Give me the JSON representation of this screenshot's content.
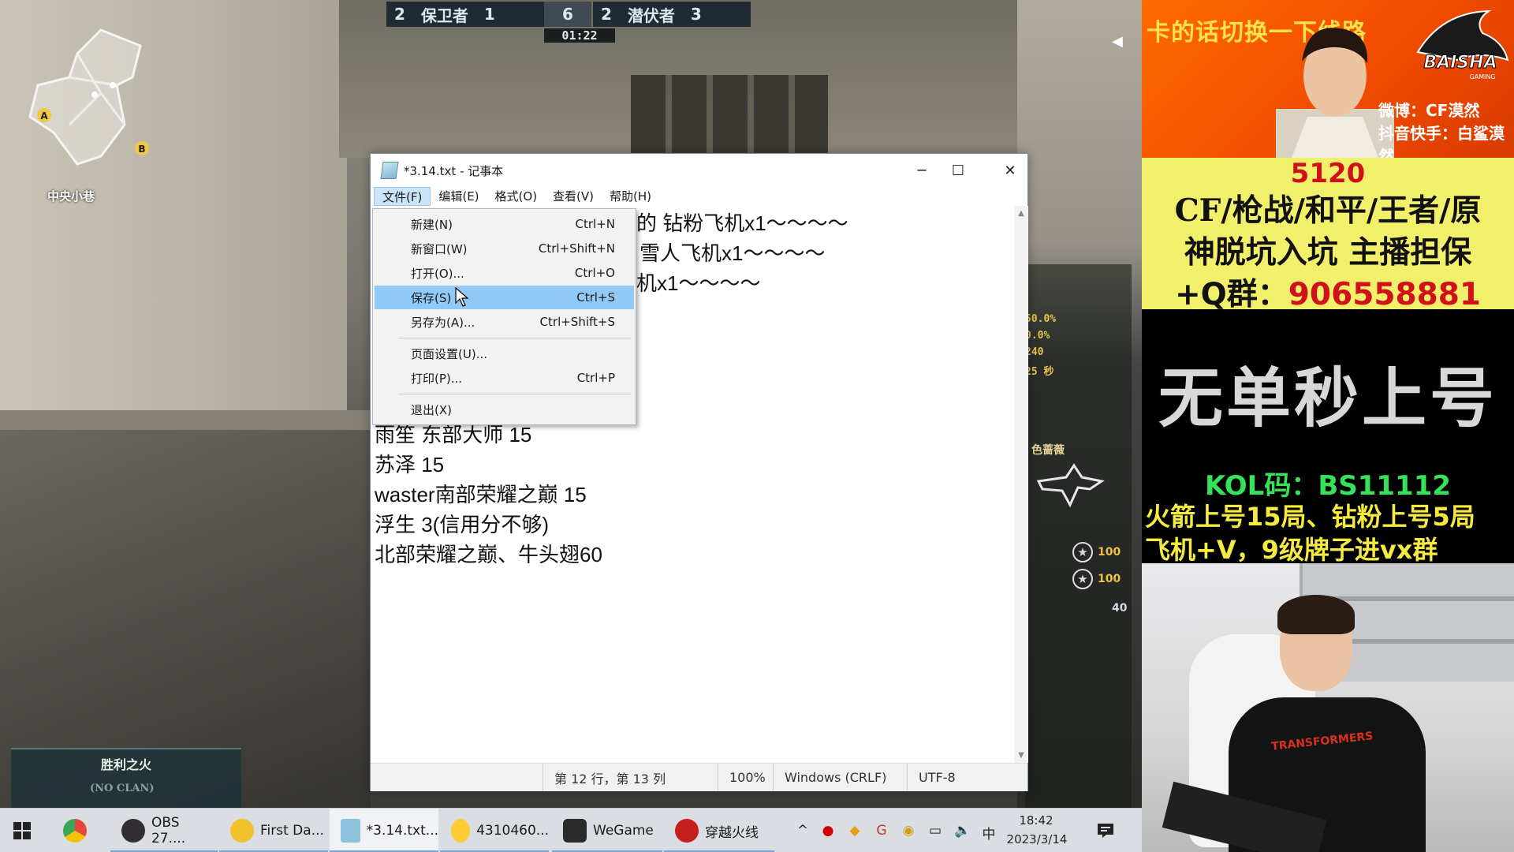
{
  "game": {
    "map_name": "中央小巷",
    "minimap_markers": [
      "A",
      "B"
    ],
    "score": {
      "left_count": "2",
      "left_team": "保卫者",
      "left_score": "1",
      "round": "6",
      "right_count": "2",
      "right_team": "潜伏者",
      "right_score": "3",
      "timer": "01:22"
    },
    "hud": {
      "pcts": [
        "50.0%",
        "0.0%",
        "240",
        "25 秒"
      ],
      "weapon_label": "色蔷薇",
      "stat_1": "100",
      "stat_2": "100",
      "ammo": "40"
    },
    "bottom_panel": {
      "title": "胜利之火",
      "subtitle": "(NO CLAN)"
    }
  },
  "notepad": {
    "title": "*3.14.txt - 记事本",
    "window_controls": [
      "─",
      "☐",
      "✕"
    ],
    "menus": [
      "文件(F)",
      "编辑(E)",
      "格式(O)",
      "查看(V)",
      "帮助(H)"
    ],
    "active_menu": "文件(F)",
    "visible_lines": [
      {
        "text": "的 钻粉飞机x1～～～～",
        "partial": true
      },
      {
        "text": "雪人飞机x1～～～～",
        "partial": true
      },
      {
        "text": "机x1～～～～",
        "partial": true
      },
      {
        "text": "雨笙 东部大师 15",
        "partial": false
      },
      {
        "text": "苏泽 15",
        "partial": false
      },
      {
        "text": "waster南部荣耀之巅 15",
        "partial": false
      },
      {
        "text": "浮生 3(信用分不够)",
        "partial": false
      },
      {
        "text": "北部荣耀之巅、牛头翅60",
        "partial": false
      }
    ],
    "status": {
      "position": "第 12 行，第 13 列",
      "zoom": "100%",
      "line_ending": "Windows (CRLF)",
      "encoding": "UTF-8"
    },
    "file_menu": [
      {
        "label": "新建(N)",
        "shortcut": "Ctrl+N"
      },
      {
        "label": "新窗口(W)",
        "shortcut": "Ctrl+Shift+N"
      },
      {
        "label": "打开(O)...",
        "shortcut": "Ctrl+O"
      },
      {
        "label": "保存(S)",
        "shortcut": "Ctrl+S",
        "highlighted": true
      },
      {
        "label": "另存为(A)...",
        "shortcut": "Ctrl+Shift+S"
      },
      {
        "label": "页面设置(U)...",
        "shortcut": ""
      },
      {
        "label": "打印(P)...",
        "shortcut": "Ctrl+P"
      },
      {
        "label": "退出(X)",
        "shortcut": ""
      }
    ]
  },
  "overlay": {
    "banner_text": "卡的话切换一下线路",
    "logo_text": "BAISHA",
    "logo_sub": "GAMING",
    "weibo": "微博：CF漠然",
    "douyin": "抖音快手：白鲨漠然",
    "promo_number": "5120",
    "promo_line1": "CF/枪战/和平/王者/原",
    "promo_line2": "神脱坑入坑 主播担保",
    "qq_label": "+Q群：",
    "qq_number": "906558881",
    "slogan": "无单秒上号",
    "kol": "KOL码：BS11112",
    "rocket": "火箭上号15局、钻粉上号5局",
    "plane": "飞机+V，9级牌子进vx群",
    "shirt_text": "TRANSFORMERS"
  },
  "taskbar": {
    "items": [
      {
        "name": "chrome",
        "label": "",
        "color": "#e8453c"
      },
      {
        "name": "obs",
        "label": "OBS 27....",
        "color": "#302e31"
      },
      {
        "name": "first-da",
        "label": "First Da...",
        "color": "#f2c12e"
      },
      {
        "name": "notepad",
        "label": "*3.14.txt...",
        "color": "#8fc3dd"
      },
      {
        "name": "qq",
        "label": "4310460...",
        "color": "#ffcc33"
      },
      {
        "name": "wegame",
        "label": "WeGame",
        "color": "#2a2a2a"
      },
      {
        "name": "cf",
        "label": "穿越火线",
        "color": "#c81e1e"
      }
    ],
    "tray": [
      "^",
      "●",
      "◆",
      "G",
      "◉",
      "▭",
      "🔈",
      "中"
    ],
    "time": "18:42",
    "date": "2023/3/14"
  },
  "colors": {
    "menu_highlight": "#91c9f7",
    "promo_bg": "#f2ef6a",
    "banner_orange": "#f04a00",
    "qq_red": "#d0111b",
    "kol_green": "#35e35a"
  }
}
